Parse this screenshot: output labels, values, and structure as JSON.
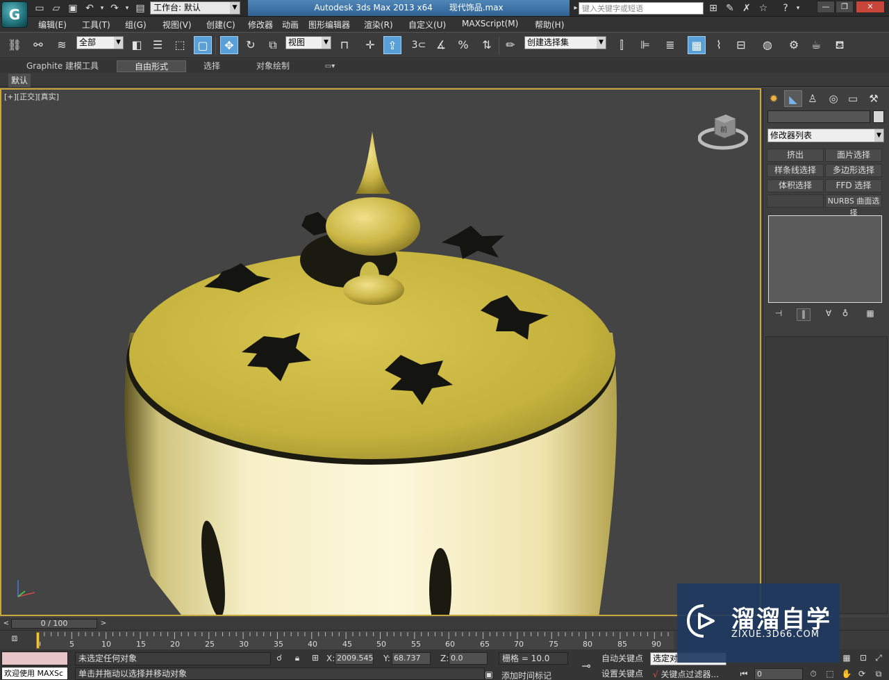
{
  "titlebar": {
    "workspace": "工作台: 默认",
    "app_title": "Autodesk 3ds Max  2013 x64",
    "file_name": "现代饰品.max",
    "search_placeholder": "键入关键字或短语"
  },
  "menu": {
    "items": [
      "编辑(E)",
      "工具(T)",
      "组(G)",
      "视图(V)",
      "创建(C)",
      "修改器",
      "动画",
      "图形编辑器",
      "渲染(R)",
      "自定义(U)",
      "MAXScript(M)",
      "帮助(H)"
    ]
  },
  "toolbar": {
    "selection_filter": "全部",
    "reference_coord": "视图",
    "snap_angle": "3",
    "named_selection": "创建选择集"
  },
  "ribbon": {
    "tabs": [
      "Graphite 建模工具",
      "自由形式",
      "选择",
      "对象绘制"
    ],
    "active_tab": "自由形式",
    "panel_label": "默认"
  },
  "viewport": {
    "label": "[+][正交][真实]",
    "viewcube_face": "前",
    "object_color": "#c9b43a",
    "border_color": "#c9a93b"
  },
  "command_panel": {
    "modifier_list": "修改器列表",
    "modifier_buttons": [
      "挤出",
      "面片选择",
      "样条线选择",
      "多边形选择",
      "体积选择",
      "FFD 选择",
      "",
      "NURBS 曲面选择"
    ]
  },
  "timeline": {
    "frame_display": "0 / 100",
    "ticks": [
      "0",
      "5",
      "10",
      "15",
      "20",
      "25",
      "30",
      "35",
      "40",
      "45",
      "50",
      "55",
      "60",
      "65",
      "70",
      "75",
      "80",
      "85",
      "90"
    ]
  },
  "statusbar": {
    "maxscript_text": "欢迎使用 MAXSc",
    "status_line1": "未选定任何对象",
    "status_line2": "单击并拖动以选择并移动对象",
    "x_value": "2009.545",
    "y_value": "68.737",
    "z_value": "0.0",
    "grid": "栅格 = 10.0",
    "add_time_tag": "添加时间标记",
    "auto_key": "自动关键点",
    "set_key": "设置关键点",
    "selected_mode": "选定对",
    "key_filter": "关键点过滤器...",
    "current_frame": "0"
  },
  "watermark": {
    "title": "溜溜自学",
    "subtitle": "ZIXUE.3D66.COM"
  }
}
